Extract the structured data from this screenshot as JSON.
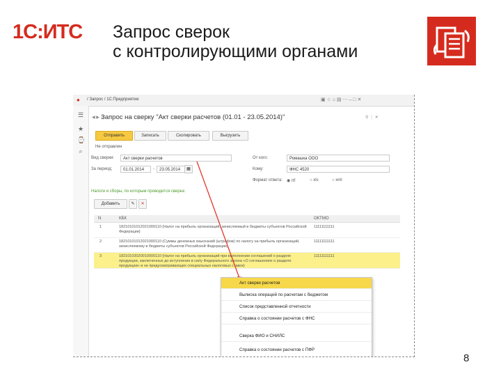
{
  "slide": {
    "logo_text": "1С:ИТС",
    "title_line1": "Запрос сверок",
    "title_line2": "с контролирующими органами",
    "page_number": "8",
    "accent": "#d52b1e",
    "icon": "document-exchange-icon"
  },
  "app": {
    "breadcrumb": "/ Запрос / 1С:Предприятие",
    "window_title": "Запрос на сверку \"Акт сверки расчетов (01.01 - 23.05.2014)\"",
    "toolbar": {
      "send": "Отправить",
      "save": "Записать",
      "copy": "Скопировать",
      "upload": "Выгрузить"
    },
    "status": "Не отправлен",
    "labels": {
      "request_type": "Вид сверки:",
      "period": "За период:",
      "from_org": "От кого:",
      "to_whom": "Кому:",
      "format": "Формат ответа:",
      "period_dash": "-"
    },
    "values": {
      "request_type": "Акт сверки расчетов",
      "period_from": "01.01.2014",
      "period_to": "23.05.2014",
      "from_org": "Ромашка ООО",
      "to_whom": "ФНС 4520",
      "format_options": [
        "rtf",
        "xls",
        "xml"
      ]
    },
    "section_link": "Налоги и сборы, по которым проводится сверка:",
    "add_button": "Добавить",
    "grid_headers": {
      "n": "N",
      "kbk": "КБК",
      "oktmo": "ОКТМО"
    },
    "rows": [
      {
        "n": "1",
        "kbk": "18210101012021000110 (Налог на прибыль организаций, зачисляемый в бюджеты субъектов Российской Федерации)",
        "oktmo": "11111111111"
      },
      {
        "n": "2",
        "kbk": "18210101012021000110 (Суммы денежных взысканий (штрафов) по налогу на прибыль организаций, зачисляемому в бюджеты субъектов Российской Федерации)",
        "oktmo": "11111111111"
      },
      {
        "n": "3",
        "kbk": "18210103020010000110 (Налог на прибыль организаций при выполнении соглашений о разделе продукции, заключенных до вступления в силу Федерального закона «О соглашениях о разделе продукции» и не предусматривающих специальных налоговых ставок)",
        "oktmo": "11111111111"
      }
    ],
    "dropdown": [
      "Акт сверки расчетов",
      "Выписка операций по расчетам с бюджетом",
      "Список представленной отчетности",
      "Справка о состоянии расчетов с ФНС",
      "Сверка ФИО и СНИЛС",
      "Справка о состоянии расчетов с ПФР"
    ]
  }
}
